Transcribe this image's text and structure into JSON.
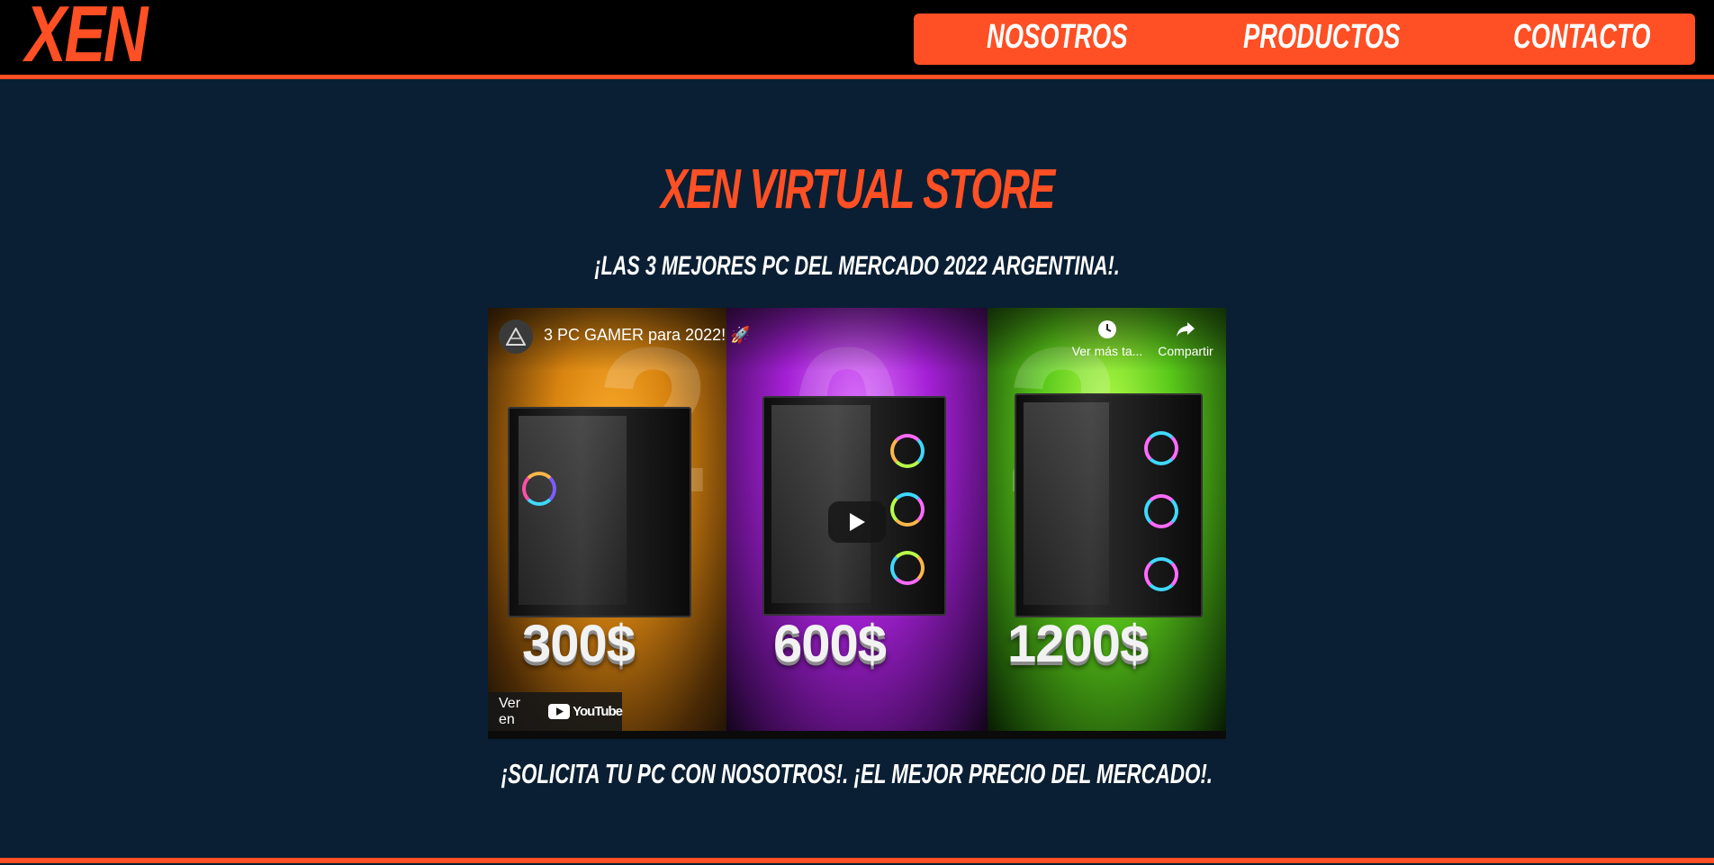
{
  "header": {
    "logo": "XEN",
    "nav": [
      "NOSOTROS",
      "PRODUCTOS",
      "CONTACTO"
    ]
  },
  "main": {
    "title": "XEN VIRTUAL STORE",
    "subtitle": "¡LAS 3 MEJORES PC DEL MERCADO 2022 ARGENTINA!.",
    "tagline": "¡SOLICITA TU PC CON NOSOTROS!. ¡EL MEJOR PRECIO DEL MERCADO!."
  },
  "video": {
    "title": "3 PC GAMER para 2022! 🚀",
    "watch_later_label": "Ver más ta...",
    "share_label": "Compartir",
    "watch_on_label": "Ver en",
    "youtube_label": "YouTube",
    "thumbnail_prices": [
      "300$",
      "600$",
      "1200$"
    ],
    "thumbnail_big_number": "2"
  },
  "colors": {
    "accent": "#ff4f24",
    "background": "#0a1f33",
    "header_bg": "#000000"
  }
}
